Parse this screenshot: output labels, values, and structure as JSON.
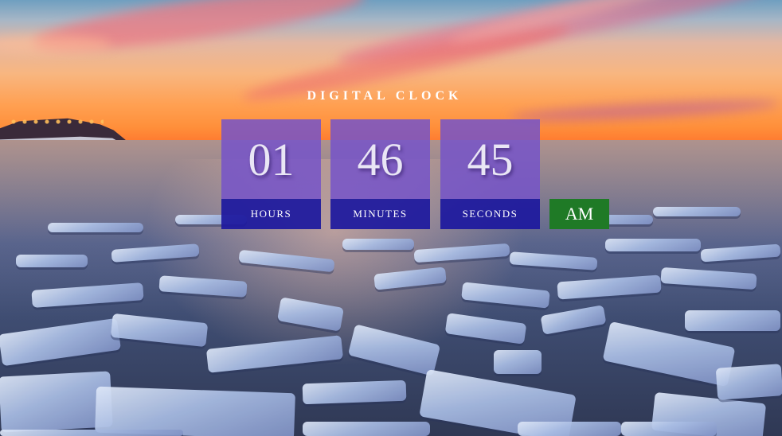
{
  "clock": {
    "title": "DIGITAL CLOCK",
    "hours": "01",
    "minutes": "46",
    "seconds": "45",
    "hours_label": "HOURS",
    "minutes_label": "MINUTES",
    "seconds_label": "SECONDS",
    "period": "AM"
  },
  "colors": {
    "number_box": "#7654c8",
    "label_box": "#1c189e",
    "period_box": "#1f7a26"
  }
}
